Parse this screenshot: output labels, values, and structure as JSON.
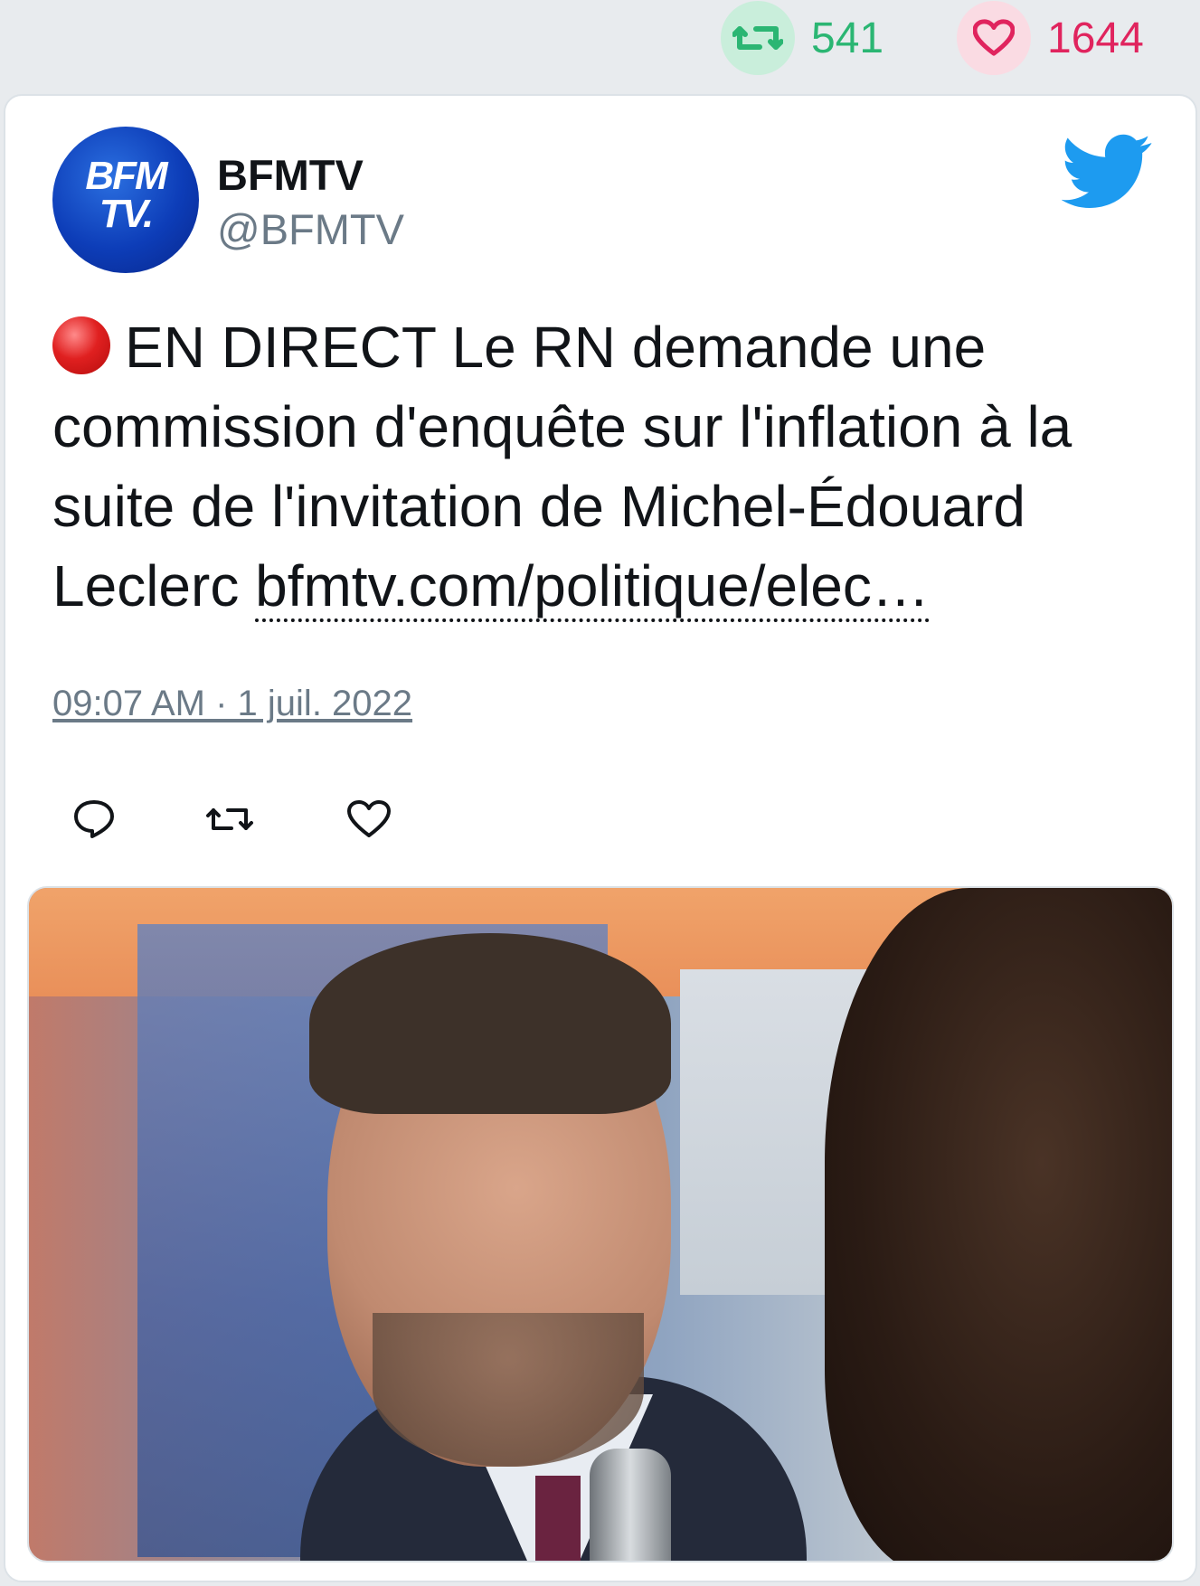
{
  "stats": {
    "retweet_count": "541",
    "like_count": "1644",
    "retweet_color": "#2bb673",
    "like_color": "#e0245e"
  },
  "author": {
    "avatar_text_line1": "BFM",
    "avatar_text_line2": "TV.",
    "name": "BFMTV",
    "handle": "@BFMTV"
  },
  "tweet": {
    "text": "EN DIRECT Le RN demande une commission d'enquête sur l'inflation à la suite de l'invitation de Michel-Édouard Leclerc",
    "link_text": "bfmtv.com/politique/elec…",
    "timestamp": "09:07 AM · 1 juil. 2022",
    "live_indicator_icon": "red-circle-icon"
  },
  "actions": {
    "reply_icon": "reply-icon",
    "retweet_icon": "retweet-icon",
    "like_icon": "heart-icon"
  },
  "brand": {
    "twitter_blue": "#1d9bf0"
  }
}
